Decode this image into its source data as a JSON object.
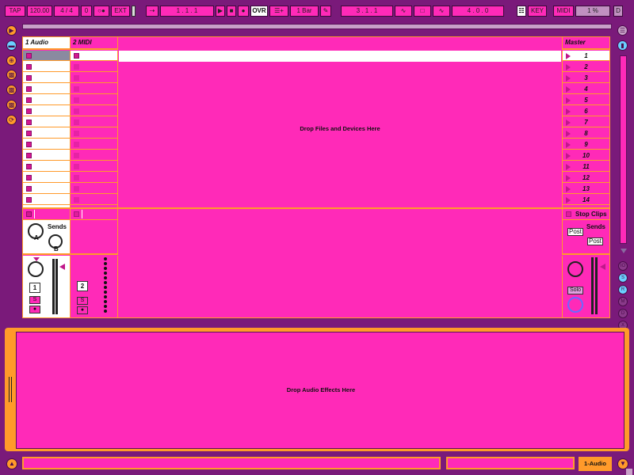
{
  "transport": {
    "tap": "TAP",
    "tempo": "120.00",
    "sig": "4 / 4",
    "metro": "0",
    "follow": "○●",
    "ext": "EXT",
    "position": "1 .  1 .  1",
    "ovr": "OVR",
    "quant": "1 Bar",
    "loop_start": "3 .  1 .  1",
    "loop_len": "4 .  0 .  0",
    "key": "KEY",
    "midi": "MIDI",
    "cpu": "1 %",
    "d": "D"
  },
  "tracks": {
    "audio_title": "1 Audio",
    "midi_title": "2 MIDI",
    "master_title": "Master",
    "drop_files": "Drop Files and Devices Here",
    "stop_clips": "Stop Clips",
    "scenes": [
      "1",
      "2",
      "3",
      "4",
      "5",
      "6",
      "7",
      "8",
      "9",
      "10",
      "11",
      "12",
      "13",
      "14"
    ]
  },
  "mixer": {
    "sends": "Sends",
    "send_a": "A",
    "send_b": "B",
    "track1_num": "1",
    "track2_num": "2",
    "solo": "S",
    "master_sends": "Sends",
    "post1": "Post",
    "post2": "Post",
    "master_solo": "Solo"
  },
  "right_rail": [
    "IO",
    "S",
    "R",
    "M",
    "D",
    "X"
  ],
  "devices": {
    "drop_effects": "Drop Audio Effects Here"
  },
  "status": {
    "track_name": "1-Audio"
  }
}
